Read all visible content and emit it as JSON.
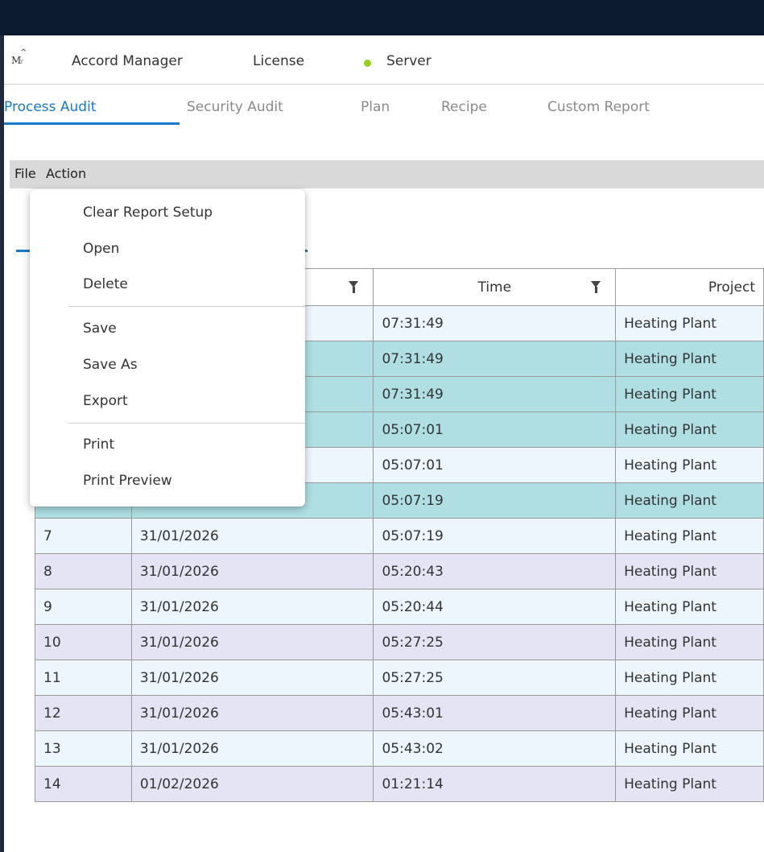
{
  "app": {
    "logo_letter": "M",
    "menu": {
      "accord_manager": "Accord Manager",
      "license": "License",
      "server": "Server"
    },
    "colors": {
      "server_status": "#8fd11b",
      "accent": "#1779c7"
    }
  },
  "tabs": [
    "Process Audit",
    "Security Audit",
    "Plan",
    "Recipe",
    "Custom Report"
  ],
  "active_tab": "Process Audit",
  "menubar": {
    "file": "File",
    "action": "Action"
  },
  "file_menu": {
    "clear_report_setup": "Clear Report Setup",
    "open": "Open",
    "delete": "Delete",
    "save": "Save",
    "save_as": "Save As",
    "export": "Export",
    "print": "Print",
    "print_preview": "Print Preview"
  },
  "table": {
    "columns": {
      "time": "Time",
      "project": "Project"
    },
    "rows": [
      {
        "no": "",
        "date": "",
        "time": "07:31:49",
        "project": "Heating Plant",
        "style": "light"
      },
      {
        "no": "",
        "date": "",
        "time": "07:31:49",
        "project": "Heating Plant",
        "style": "teal"
      },
      {
        "no": "",
        "date": "",
        "time": "07:31:49",
        "project": "Heating Plant",
        "style": "teal"
      },
      {
        "no": "",
        "date": "",
        "time": "05:07:01",
        "project": "Heating Plant",
        "style": "teal"
      },
      {
        "no": "",
        "date": "",
        "time": "05:07:01",
        "project": "Heating Plant",
        "style": "light"
      },
      {
        "no": "",
        "date": "",
        "time": "05:07:19",
        "project": "Heating Plant",
        "style": "teal"
      },
      {
        "no": "7",
        "date": "31/01/2026",
        "time": "05:07:19",
        "project": "Heating Plant",
        "style": "light"
      },
      {
        "no": "8",
        "date": "31/01/2026",
        "time": "05:20:43",
        "project": "Heating Plant",
        "style": "lav"
      },
      {
        "no": "9",
        "date": "31/01/2026",
        "time": "05:20:44",
        "project": "Heating Plant",
        "style": "light"
      },
      {
        "no": "10",
        "date": "31/01/2026",
        "time": "05:27:25",
        "project": "Heating Plant",
        "style": "lav"
      },
      {
        "no": "11",
        "date": "31/01/2026",
        "time": "05:27:25",
        "project": "Heating Plant",
        "style": "light"
      },
      {
        "no": "12",
        "date": "31/01/2026",
        "time": "05:43:01",
        "project": "Heating Plant",
        "style": "lav"
      },
      {
        "no": "13",
        "date": "31/01/2026",
        "time": "05:43:02",
        "project": "Heating Plant",
        "style": "light"
      },
      {
        "no": "14",
        "date": "01/02/2026",
        "time": "01:21:14",
        "project": "Heating Plant",
        "style": "lav"
      }
    ]
  }
}
